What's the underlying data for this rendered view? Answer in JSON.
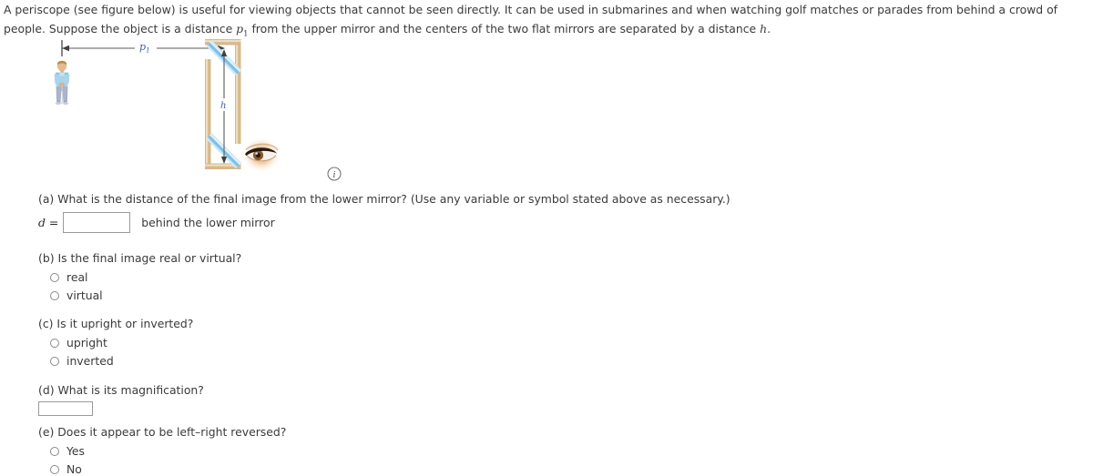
{
  "problem": {
    "text_part1": "A periscope (see figure below) is useful for viewing objects that cannot be seen directly. It can be used in submarines and when watching golf matches or parades from behind a crowd of people. Suppose the object is a distance ",
    "symbol_p1": "p",
    "symbol_p1_sub": "1",
    "text_part2": " from the upper mirror and the centers of the two flat mirrors are separated by a distance ",
    "symbol_h": "h",
    "text_part3": "."
  },
  "figure": {
    "label_p1": "p",
    "label_p1_sub": "1",
    "label_h": "h",
    "info_icon_label": "i",
    "colors": {
      "frame": "#d6b98c",
      "frame_light": "#efdcbd",
      "mirror": "#7fc2e8",
      "mirror_light": "#cfe8f6",
      "arrow": "#4a4a4a",
      "label": "#3b5ea8",
      "skin": "#e8bb8f",
      "shirt": "#a8d4ec",
      "pants": "#9aa6c4",
      "hair": "#c08a4a"
    }
  },
  "questions": [
    {
      "id": "a",
      "prompt": "(a) What is the distance of the final image from the lower mirror? (Use any variable or symbol stated above as necessary.)",
      "type": "input",
      "eq_label": "d =",
      "value": "",
      "placeholder": "",
      "suffix": "behind the lower mirror"
    },
    {
      "id": "b",
      "prompt": "(b) Is the final image real or virtual?",
      "type": "radio",
      "options": [
        "real",
        "virtual"
      ]
    },
    {
      "id": "c",
      "prompt": "(c) Is it upright or inverted?",
      "type": "radio",
      "options": [
        "upright",
        "inverted"
      ]
    },
    {
      "id": "d",
      "prompt": "(d) What is its magnification?",
      "type": "input",
      "eq_label": "",
      "value": "",
      "placeholder": "",
      "suffix": ""
    },
    {
      "id": "e",
      "prompt": "(e) Does it appear to be left–right reversed?",
      "type": "radio",
      "options": [
        "Yes",
        "No"
      ]
    }
  ]
}
